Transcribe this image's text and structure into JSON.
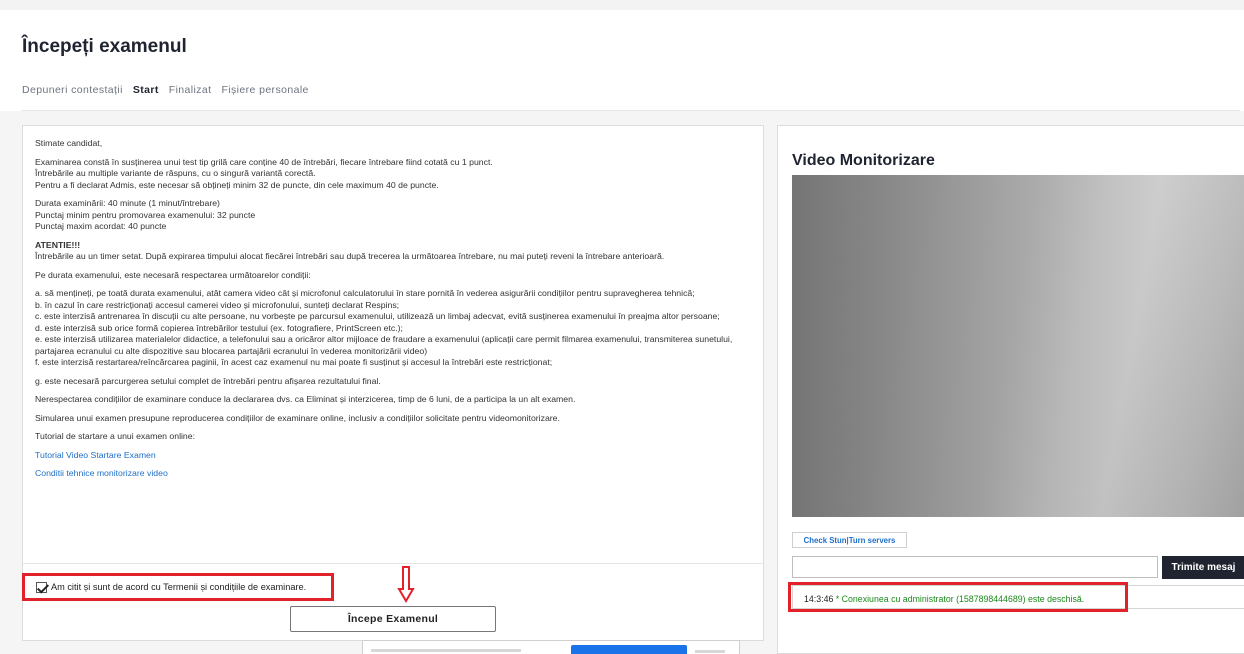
{
  "page": {
    "title": "Începeți examenul"
  },
  "tabs": [
    {
      "label": "Depuneri contestații",
      "active": false
    },
    {
      "label": "Start",
      "active": true
    },
    {
      "label": "Finalizat",
      "active": false
    },
    {
      "label": "Fișiere personale",
      "active": false
    }
  ],
  "instructions": {
    "greeting": "Stimate candidat,",
    "intro": [
      "Examinarea constă în susținerea unui test tip grilă care conține 40 de întrebări, fiecare întrebare fiind cotată cu 1 punct.",
      "Întrebările au multiple variante de răspuns, cu o singură variantă corectă.",
      "Pentru a fi declarat Admis, este necesar să obțineți minim 32 de puncte, din cele maximum 40 de puncte."
    ],
    "details": [
      "Durata examinării: 40 minute (1 minut/întrebare)",
      "Punctaj minim pentru promovarea examenului: 32 puncte",
      "Punctaj maxim acordat: 40 puncte"
    ],
    "attention_title": "ATENTIE!!!",
    "attention_text": "Întrebările au un timer setat. După expirarea timpului alocat fiecărei întrebări sau după trecerea la următoarea întrebare, nu mai puteți reveni la întrebare anterioară.",
    "conditions_intro": "Pe durata examenului, este necesară respectarea următoarelor condiții:",
    "conditions": [
      "a. să mențineți, pe toată durata examenului, atât camera video cât și microfonul calculatorului în stare pornită în vederea asigurării condițiilor pentru supravegherea tehnică;",
      "b. în cazul în care restricționați accesul camerei video și microfonului, sunteți declarat Respins;",
      "c. este interzisă antrenarea în discuții cu alte persoane, nu vorbește pe parcursul examenului, utilizează un limbaj adecvat, evită susținerea examenului în preajma altor persoane;",
      "d. este interzisă sub orice formă copierea întrebărilor testului (ex. fotografiere, PrintScreen etc.);",
      "e. este interzisă utilizarea materialelor didactice, a telefonului sau a oricăror altor mijloace de fraudare a examenului (aplicații care permit filmarea examenului, transmiterea sunetului, partajarea ecranului cu alte dispozitive sau blocarea partajării ecranului în vederea monitorizării video)",
      "f. este interzisă restartarea/reîncărcarea paginii, în acest caz examenul nu mai poate fi susținut și accesul la întrebări este restricționat;"
    ],
    "condition_g": "g. este necesară parcurgerea setului complet de întrebări pentru afișarea rezultatului final.",
    "penalty": "Nerespectarea condițiilor de examinare conduce la declararea dvs. ca Eliminat și interzicerea, timp de 6 luni, de a participa la un alt examen.",
    "simulation": "Simularea unui examen presupune reproducerea condițiilor de examinare online, inclusiv a condițiilor solicitate pentru videomonitorizare.",
    "tutorial_intro": "Tutorial de startare a unui examen online:",
    "link_tutorial": "Tutorial Video Startare Examen",
    "link_conditions": "Conditii tehnice monitorizare video"
  },
  "agreement": {
    "label": "Am citit și sunt de acord cu Termenii și condițiile de examinare.",
    "checked": true
  },
  "start_button": "Începe Examenul",
  "video_panel": {
    "title": "Video Monitorizare",
    "check_button": "Check Stun|Turn servers",
    "message_placeholder": "",
    "send_button": "Trimite mesaj",
    "log": {
      "time": "14:3:46",
      "message": " * Conexiunea cu administrator (1587898444689) este deschisă."
    }
  },
  "colors": {
    "highlight": "#e2222a",
    "link": "#1e6fc9",
    "success": "#1c8a1c",
    "dark": "#1f2430"
  }
}
